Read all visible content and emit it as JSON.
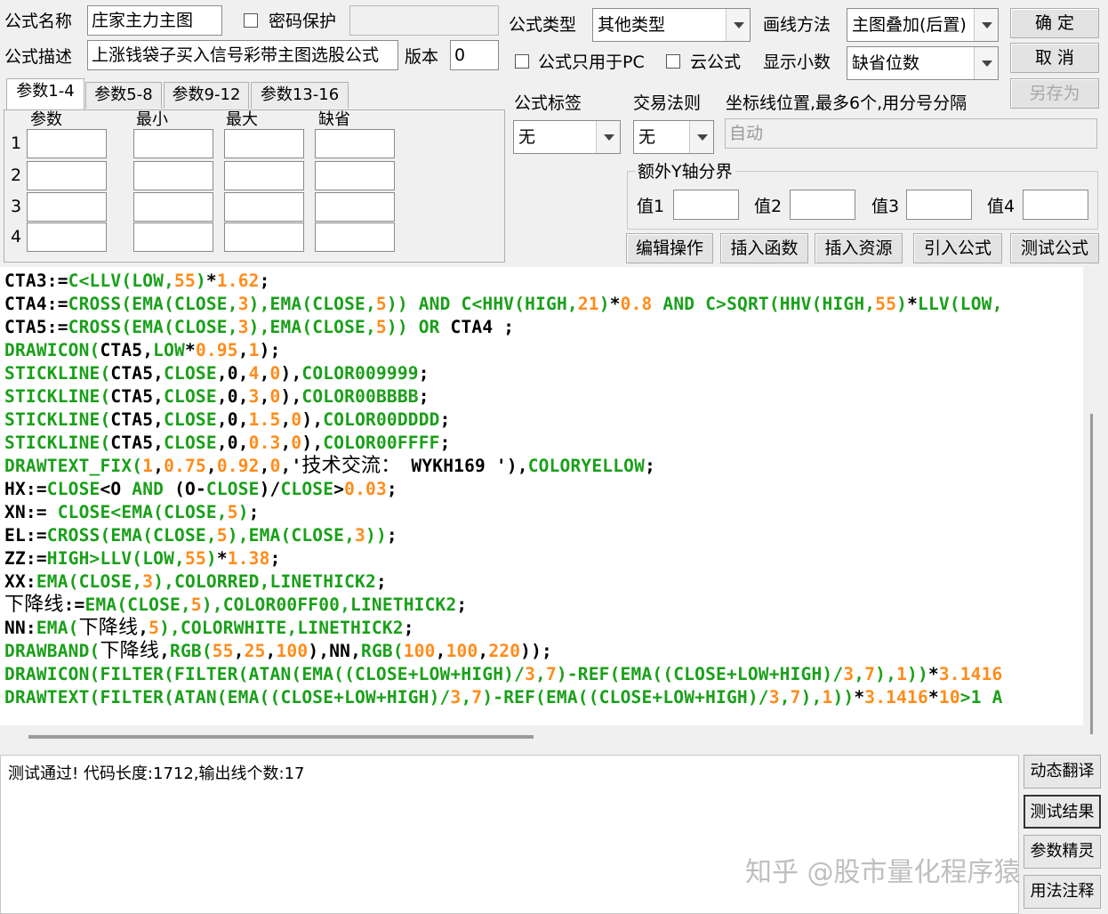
{
  "header": {
    "name_label": "公式名称",
    "name_value": "庄家主力主图",
    "password_label": "密码保护",
    "desc_label": "公式描述",
    "desc_value": "上涨钱袋子买入信号彩带主图选股公式",
    "version_label": "版本",
    "version_value": "0",
    "type_label": "公式类型",
    "type_value": "其他类型",
    "draw_label": "画线方法",
    "draw_value": "主图叠加(后置)",
    "pc_only_label": "公式只用于PC",
    "cloud_label": "云公式",
    "decimal_label": "显示小数",
    "decimal_value": "缺省位数"
  },
  "buttons": {
    "ok": "确  定",
    "cancel": "取  消",
    "save_as": "另存为",
    "edit_ops": "编辑操作",
    "insert_func": "插入函数",
    "insert_res": "插入资源",
    "import_formula": "引入公式",
    "test_formula": "测试公式"
  },
  "params": {
    "tabs": [
      "参数1-4",
      "参数5-8",
      "参数9-12",
      "参数13-16"
    ],
    "columns": [
      "参数",
      "最小",
      "最大",
      "缺省"
    ],
    "rows": [
      "1",
      "2",
      "3",
      "4"
    ]
  },
  "options": {
    "tag_label": "公式标签",
    "tag_value": "无",
    "trade_label": "交易法则",
    "trade_value": "无",
    "axis_label": "坐标线位置,最多6个,用分号分隔",
    "axis_value": "自动",
    "extra_y_label": "额外Y轴分界",
    "val_labels": [
      "值1",
      "值2",
      "值3",
      "值4"
    ]
  },
  "code_lines": [
    [
      [
        "k",
        "CTA3:="
      ],
      [
        "f",
        "C<LLV(LOW,"
      ],
      [
        "n",
        "55"
      ],
      [
        "f",
        ")"
      ],
      [
        "k",
        "*"
      ],
      [
        "n",
        "1.62"
      ],
      [
        "k",
        ";"
      ]
    ],
    [
      [
        "k",
        "CTA4:="
      ],
      [
        "f",
        "CROSS(EMA(CLOSE,"
      ],
      [
        "n",
        "3"
      ],
      [
        "f",
        "),EMA(CLOSE,"
      ],
      [
        "n",
        "5"
      ],
      [
        "f",
        "))"
      ],
      [
        "k",
        " "
      ],
      [
        "f",
        "AND"
      ],
      [
        "k",
        " "
      ],
      [
        "f",
        "C<HHV(HIGH,"
      ],
      [
        "n",
        "21"
      ],
      [
        "f",
        ")"
      ],
      [
        "k",
        "*"
      ],
      [
        "n",
        "0.8"
      ],
      [
        "k",
        " "
      ],
      [
        "f",
        "AND"
      ],
      [
        "k",
        " "
      ],
      [
        "f",
        "C>SQRT(HHV(HIGH,"
      ],
      [
        "n",
        "55"
      ],
      [
        "f",
        ")"
      ],
      [
        "k",
        "*"
      ],
      [
        "f",
        "LLV(LOW,"
      ]
    ],
    [
      [
        "k",
        "CTA5:="
      ],
      [
        "f",
        "CROSS(EMA(CLOSE,"
      ],
      [
        "n",
        "3"
      ],
      [
        "f",
        "),EMA(CLOSE,"
      ],
      [
        "n",
        "5"
      ],
      [
        "f",
        "))"
      ],
      [
        "k",
        " "
      ],
      [
        "f",
        "OR"
      ],
      [
        "k",
        " CTA4 ;"
      ]
    ],
    [
      [
        "f",
        "DRAWICON("
      ],
      [
        "k",
        "CTA5,"
      ],
      [
        "f",
        "LOW"
      ],
      [
        "k",
        "*"
      ],
      [
        "n",
        "0.95"
      ],
      [
        "k",
        ","
      ],
      [
        "n",
        "1"
      ],
      [
        "k",
        ");"
      ]
    ],
    [
      [
        "f",
        "STICKLINE("
      ],
      [
        "k",
        "CTA5,"
      ],
      [
        "f",
        "CLOSE"
      ],
      [
        "k",
        ",0,"
      ],
      [
        "n",
        "4"
      ],
      [
        "k",
        ","
      ],
      [
        "n",
        "0"
      ],
      [
        "k",
        "),"
      ],
      [
        "f",
        "COLOR009999"
      ],
      [
        "k",
        ";"
      ]
    ],
    [
      [
        "f",
        "STICKLINE("
      ],
      [
        "k",
        "CTA5,"
      ],
      [
        "f",
        "CLOSE"
      ],
      [
        "k",
        ",0,"
      ],
      [
        "n",
        "3"
      ],
      [
        "k",
        ","
      ],
      [
        "n",
        "0"
      ],
      [
        "k",
        "),"
      ],
      [
        "f",
        "COLOR00BBBB"
      ],
      [
        "k",
        ";"
      ]
    ],
    [
      [
        "f",
        "STICKLINE("
      ],
      [
        "k",
        "CTA5,"
      ],
      [
        "f",
        "CLOSE"
      ],
      [
        "k",
        ",0,"
      ],
      [
        "n",
        "1.5"
      ],
      [
        "k",
        ","
      ],
      [
        "n",
        "0"
      ],
      [
        "k",
        "),"
      ],
      [
        "f",
        "COLOR00DDDD"
      ],
      [
        "k",
        ";"
      ]
    ],
    [
      [
        "f",
        "STICKLINE("
      ],
      [
        "k",
        "CTA5,"
      ],
      [
        "f",
        "CLOSE"
      ],
      [
        "k",
        ",0,"
      ],
      [
        "n",
        "0.3"
      ],
      [
        "k",
        ","
      ],
      [
        "n",
        "0"
      ],
      [
        "k",
        "),"
      ],
      [
        "f",
        "COLOR00FFFF"
      ],
      [
        "k",
        ";"
      ]
    ],
    [
      [
        "f",
        "DRAWTEXT_FIX("
      ],
      [
        "n",
        "1"
      ],
      [
        "k",
        ","
      ],
      [
        "n",
        "0.75"
      ],
      [
        "k",
        ","
      ],
      [
        "n",
        "0.92"
      ],
      [
        "k",
        ","
      ],
      [
        "n",
        "0"
      ],
      [
        "k",
        ",'"
      ],
      [
        "cn",
        "技术交流："
      ],
      [
        "k",
        " WYKH169 '),"
      ],
      [
        "f",
        "COLORYELLOW"
      ],
      [
        "k",
        ";"
      ]
    ],
    [
      [
        "k",
        "HX:="
      ],
      [
        "f",
        "CLOSE"
      ],
      [
        "k",
        "<O "
      ],
      [
        "f",
        "AND"
      ],
      [
        "k",
        " (O-"
      ],
      [
        "f",
        "CLOSE"
      ],
      [
        "k",
        ")/"
      ],
      [
        "f",
        "CLOSE"
      ],
      [
        "k",
        ">"
      ],
      [
        "n",
        "0.03"
      ],
      [
        "k",
        ";"
      ]
    ],
    [
      [
        "k",
        "XN:= "
      ],
      [
        "f",
        "CLOSE<EMA(CLOSE,"
      ],
      [
        "n",
        "5"
      ],
      [
        "f",
        ")"
      ],
      [
        "k",
        ";"
      ]
    ],
    [
      [
        "k",
        "EL:="
      ],
      [
        "f",
        "CROSS(EMA(CLOSE,"
      ],
      [
        "n",
        "5"
      ],
      [
        "f",
        "),EMA(CLOSE,"
      ],
      [
        "n",
        "3"
      ],
      [
        "f",
        "))"
      ],
      [
        "k",
        ";"
      ]
    ],
    [
      [
        "k",
        "ZZ:="
      ],
      [
        "f",
        "HIGH>LLV(LOW,"
      ],
      [
        "n",
        "55"
      ],
      [
        "f",
        ")"
      ],
      [
        "k",
        "*"
      ],
      [
        "n",
        "1.38"
      ],
      [
        "k",
        ";"
      ]
    ],
    [
      [
        "k",
        "XX:"
      ],
      [
        "f",
        "EMA(CLOSE,"
      ],
      [
        "n",
        "3"
      ],
      [
        "f",
        "),COLORRED,LINETHICK2"
      ],
      [
        "k",
        ";"
      ]
    ],
    [
      [
        "cn",
        "下降线"
      ],
      [
        "k",
        ":="
      ],
      [
        "f",
        "EMA(CLOSE,"
      ],
      [
        "n",
        "5"
      ],
      [
        "f",
        "),COLOR00FF00,LINETHICK2"
      ],
      [
        "k",
        ";"
      ]
    ],
    [
      [
        "k",
        "NN:"
      ],
      [
        "f",
        "EMA("
      ],
      [
        "cn",
        "下降线"
      ],
      [
        "k",
        ","
      ],
      [
        "n",
        "5"
      ],
      [
        "f",
        "),COLORWHITE,LINETHICK2"
      ],
      [
        "k",
        ";"
      ]
    ],
    [
      [
        "f",
        "DRAWBAND("
      ],
      [
        "cn",
        "下降线"
      ],
      [
        "k",
        ","
      ],
      [
        "f",
        "RGB("
      ],
      [
        "n",
        "55"
      ],
      [
        "k",
        ","
      ],
      [
        "n",
        "25"
      ],
      [
        "k",
        ","
      ],
      [
        "n",
        "100"
      ],
      [
        "k",
        "),NN,"
      ],
      [
        "f",
        "RGB("
      ],
      [
        "n",
        "100"
      ],
      [
        "k",
        ","
      ],
      [
        "n",
        "100"
      ],
      [
        "k",
        ","
      ],
      [
        "n",
        "220"
      ],
      [
        "k",
        "));"
      ]
    ],
    [
      [
        "f",
        "DRAWICON(FILTER(FILTER(ATAN(EMA((CLOSE+LOW+HIGH)/"
      ],
      [
        "n",
        "3"
      ],
      [
        "f",
        ","
      ],
      [
        "n",
        "7"
      ],
      [
        "f",
        ")-REF(EMA((CLOSE+LOW+HIGH)/"
      ],
      [
        "n",
        "3"
      ],
      [
        "f",
        ","
      ],
      [
        "n",
        "7"
      ],
      [
        "f",
        "),"
      ],
      [
        "n",
        "1"
      ],
      [
        "f",
        "))"
      ],
      [
        "k",
        "*"
      ],
      [
        "n",
        "3.1416"
      ]
    ],
    [
      [
        "f",
        "DRAWTEXT(FILTER(ATAN(EMA((CLOSE+LOW+HIGH)/"
      ],
      [
        "n",
        "3"
      ],
      [
        "f",
        ","
      ],
      [
        "n",
        "7"
      ],
      [
        "f",
        ")-REF(EMA((CLOSE+LOW+HIGH)/"
      ],
      [
        "n",
        "3"
      ],
      [
        "f",
        ","
      ],
      [
        "n",
        "7"
      ],
      [
        "f",
        "),"
      ],
      [
        "n",
        "1"
      ],
      [
        "f",
        "))"
      ],
      [
        "k",
        "*"
      ],
      [
        "n",
        "3.1416"
      ],
      [
        "k",
        "*"
      ],
      [
        "n",
        "10"
      ],
      [
        "f",
        ">1 A"
      ]
    ]
  ],
  "result": {
    "text": "测试通过! 代码长度:1712,输出线个数:17"
  },
  "side_buttons": [
    "动态翻译",
    "测试结果",
    "参数精灵",
    "用法注释"
  ],
  "watermark": "知乎 @股市量化程序猿"
}
